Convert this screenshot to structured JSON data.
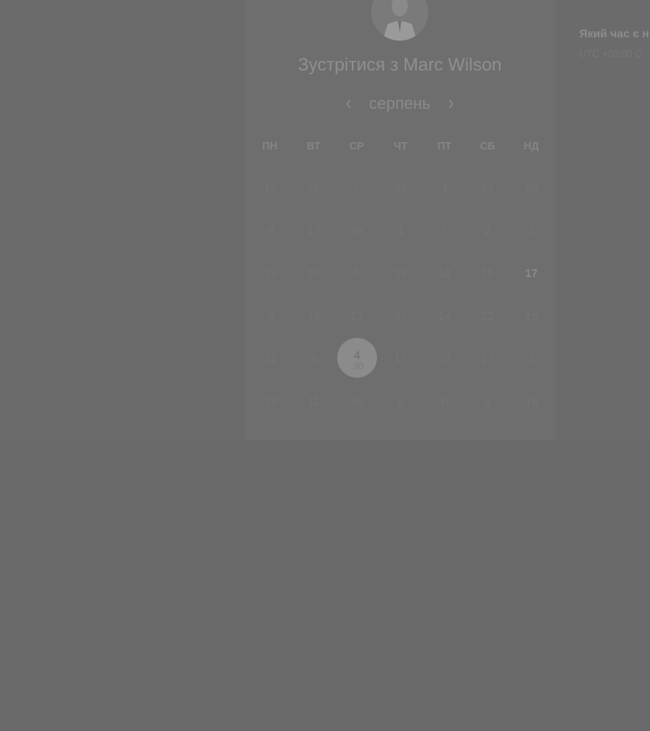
{
  "booking": {
    "title": "Зустрітися з Marc Wilson"
  },
  "calendar": {
    "month": "серпень",
    "weekdays": [
      "ПН",
      "ВТ",
      "СР",
      "ЧТ",
      "ПТ",
      "СБ",
      "НД"
    ],
    "weeks": [
      [
        "17",
        "16",
        "7",
        "24",
        "4",
        "27",
        "25"
      ],
      [
        "9",
        "17",
        "29",
        "1",
        "7",
        "2",
        "3"
      ],
      [
        "15",
        "19",
        "5",
        "19",
        "14",
        "15",
        "17"
      ],
      [
        "5",
        "19",
        "13",
        "31",
        "14",
        "22",
        "15"
      ],
      [
        "21",
        "4",
        "4",
        "17",
        "22",
        "27",
        "3"
      ],
      [
        "16",
        "11",
        "15",
        "8",
        "31",
        "4",
        "16"
      ]
    ],
    "selected_day": "4",
    "selected_ghost": "30",
    "highlighted_day": "17"
  },
  "timezone": {
    "question": "Який час є н",
    "value": "UTC +03:00 C"
  },
  "colors": {
    "overlay": "#6b6b6b",
    "selected": "#8b8b8b"
  },
  "icons": {
    "prev": "chevron-left-icon",
    "next": "chevron-right-icon",
    "avatar": "user-avatar"
  }
}
